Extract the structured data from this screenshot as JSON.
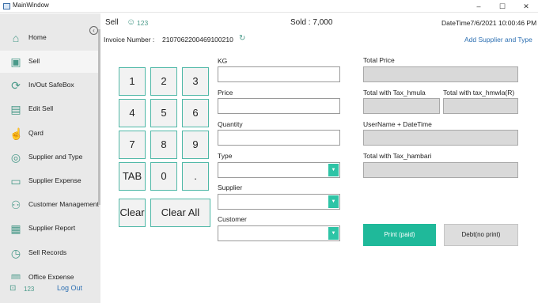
{
  "window": {
    "title": "MainWindow",
    "min_glyph": "–",
    "max_glyph": "☐",
    "close_glyph": "✕"
  },
  "sidebar": {
    "collapse_glyph": "‹",
    "items": [
      {
        "label": "Home",
        "icon": "home-icon",
        "glyph": "⌂"
      },
      {
        "label": "Sell",
        "icon": "person-card-icon",
        "glyph": "▣"
      },
      {
        "label": "In/Out SafeBox",
        "icon": "sync-icon",
        "glyph": "⟳"
      },
      {
        "label": "Edit Sell",
        "icon": "edit-list-icon",
        "glyph": "▤"
      },
      {
        "label": "Qard",
        "icon": "hand-coin-icon",
        "glyph": "☝"
      },
      {
        "label": "Supplier and Type",
        "icon": "coins-icon",
        "glyph": "◎"
      },
      {
        "label": "Supplier Expense",
        "icon": "wallet-icon",
        "glyph": "▭"
      },
      {
        "label": "Customer Management",
        "icon": "people-icon",
        "glyph": "⚇"
      },
      {
        "label": "Supplier Report",
        "icon": "report-icon",
        "glyph": "▦"
      },
      {
        "label": "Sell Records",
        "icon": "history-icon",
        "glyph": "◷"
      },
      {
        "label": "Office Expense",
        "icon": "office-icon",
        "glyph": "▥"
      }
    ],
    "footer": {
      "count": "123",
      "count_glyph": "⊡",
      "logout": "Log Out"
    }
  },
  "header": {
    "title": "Sell",
    "count": "123",
    "count_glyph": "☺",
    "sold": "Sold : 7,000",
    "datetime": "DateTime7/6/2021 10:00:46 PM",
    "invoice_label": "Invoice Number :",
    "invoice_number": "2107062200469100210",
    "refresh_glyph": "↻",
    "add_supplier": "Add Supplier and Type"
  },
  "keypad": {
    "keys": [
      "1",
      "2",
      "3",
      "4",
      "5",
      "6",
      "7",
      "8",
      "9",
      "TAB",
      "0",
      ".",
      "Clear",
      "Clear All"
    ]
  },
  "form": {
    "kg_label": "KG",
    "kg_value": "",
    "price_label": "Price",
    "price_value": "",
    "quantity_label": "Quantity",
    "quantity_value": "",
    "type_label": "Type",
    "type_value": "",
    "supplier_label": "Supplier",
    "supplier_value": "",
    "customer_label": "Customer",
    "customer_value": "",
    "dropdown_glyph": "▼"
  },
  "totals": {
    "total_price_label": "Total Price",
    "total_price_value": "",
    "tax_hmula_label": "Total with Tax_hmula",
    "tax_hmula_value": "",
    "tax_hmwla_r_label": "Total with tax_hmwla(R)",
    "tax_hmwla_r_value": "",
    "username_datetime_label": "UserName + DateTime",
    "username_datetime_value": "",
    "tax_hambari_label": "Total with Tax_hambari",
    "tax_hambari_value": ""
  },
  "actions": {
    "print_paid": "Print (paid)",
    "debt_no_print": "Debt(no print)"
  },
  "colors": {
    "accent": "#1fb99a",
    "link": "#2c6fb2",
    "icon": "#4a9a8a"
  }
}
